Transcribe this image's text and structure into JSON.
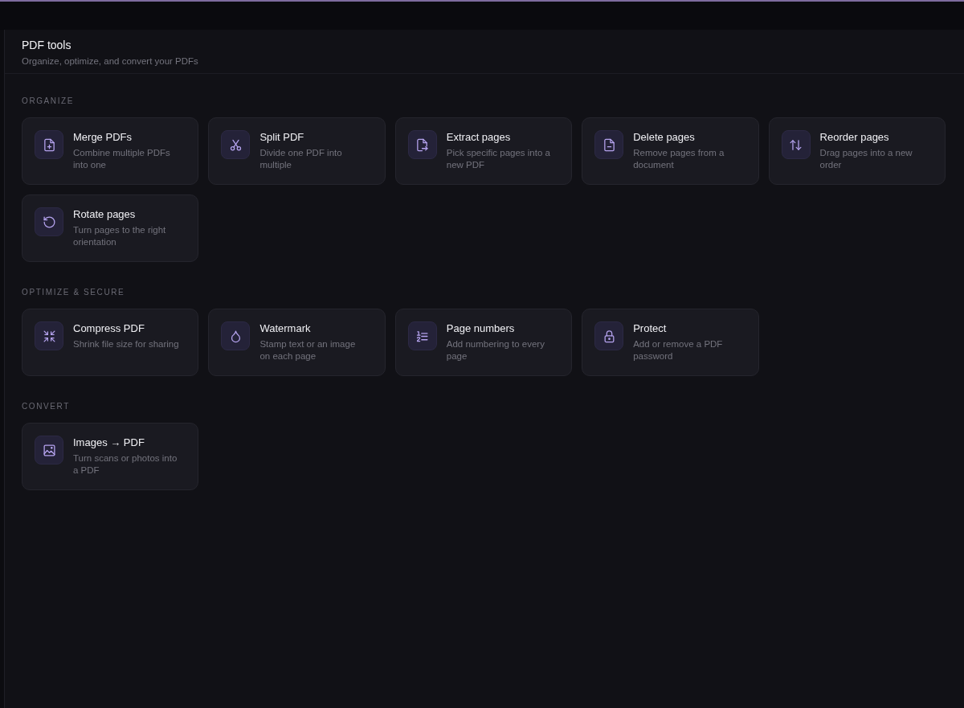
{
  "header": {
    "title": "PDF tools",
    "subtitle": "Organize, optimize, and convert your PDFs"
  },
  "sections": [
    {
      "label": "ORGANIZE",
      "tools": [
        {
          "kind": "merge",
          "title": "Merge PDFs",
          "description": "Combine multiple PDFs into one"
        },
        {
          "kind": "split",
          "title": "Split PDF",
          "description": "Divide one PDF into multiple"
        },
        {
          "kind": "extract",
          "title": "Extract pages",
          "description": "Pick specific pages into a new PDF"
        },
        {
          "kind": "delete",
          "title": "Delete pages",
          "description": "Remove pages from a document"
        },
        {
          "kind": "reorder",
          "title": "Reorder pages",
          "description": "Drag pages into a new order"
        },
        {
          "kind": "rotate",
          "title": "Rotate pages",
          "description": "Turn pages to the right orientation"
        }
      ]
    },
    {
      "label": "OPTIMIZE & SECURE",
      "tools": [
        {
          "kind": "compress",
          "title": "Compress PDF",
          "description": "Shrink file size for sharing"
        },
        {
          "kind": "watermark",
          "title": "Watermark",
          "description": "Stamp text or an image on each page"
        },
        {
          "kind": "numbering",
          "title": "Page numbers",
          "description": "Add numbering to every page"
        },
        {
          "kind": "protect",
          "title": "Protect",
          "description": "Add or remove a PDF password"
        }
      ]
    },
    {
      "label": "CONVERT",
      "tools": [
        {
          "kind": "images",
          "title": "Images → PDF",
          "description": "Turn scans or photos into a PDF"
        }
      ]
    }
  ]
}
